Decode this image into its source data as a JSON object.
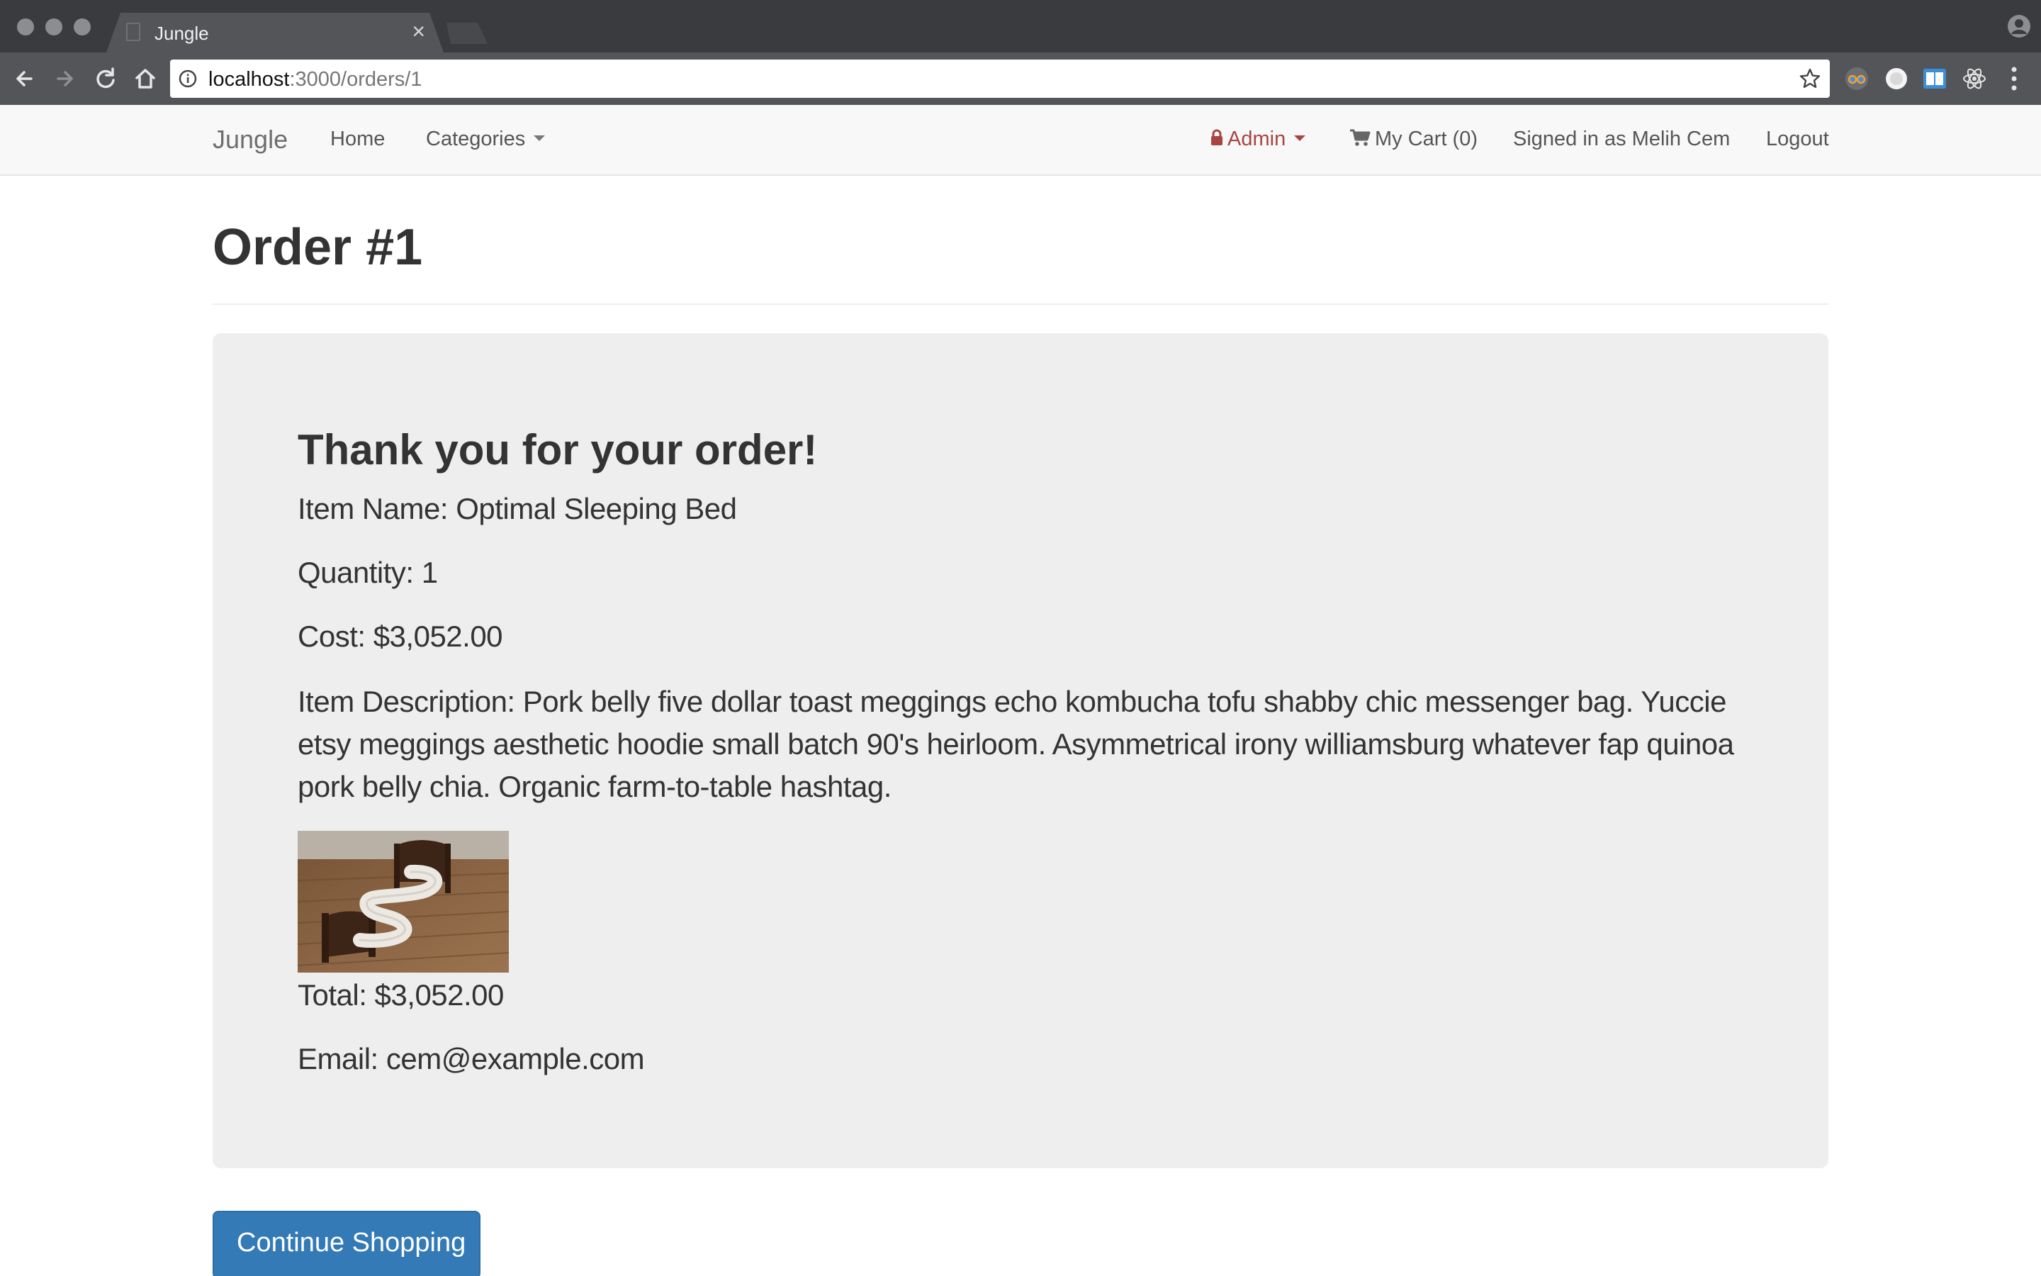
{
  "browser": {
    "tab_title": "Jungle",
    "tab_close": "×",
    "url_host": "localhost",
    "url_path": ":3000/orders/1"
  },
  "navbar": {
    "brand": "Jungle",
    "home": "Home",
    "categories": "Categories",
    "admin": "Admin",
    "cart": "My Cart (0)",
    "signed_in": "Signed in as Melih Cem",
    "logout": "Logout",
    "admin_color": "#a94442"
  },
  "page": {
    "title": "Order #1"
  },
  "order": {
    "heading": "Thank you for your order!",
    "item_name": "Item Name: Optimal Sleeping Bed",
    "quantity": "Quantity: 1",
    "cost": "Cost: $3,052.00",
    "description": "Item Description: Pork belly five dollar toast meggings echo kombucha tofu shabby chic messenger bag. Yuccie etsy meggings aesthetic hoodie small batch 90's heirloom. Asymmetrical irony williamsburg whatever fap quinoa pork belly chia. Organic farm-to-table hashtag.",
    "total": "Total: $3,052.00",
    "email": "Email: cem@example.com"
  },
  "actions": {
    "continue_shopping": "Continue Shopping",
    "primary_color": "#337ab7"
  },
  "icons": {
    "back": "back-arrow-icon",
    "forward": "forward-arrow-icon",
    "reload": "reload-icon",
    "home": "home-icon",
    "info": "info-icon",
    "star": "bookmark-star-icon",
    "lock": "lock-icon",
    "cart": "cart-icon"
  }
}
